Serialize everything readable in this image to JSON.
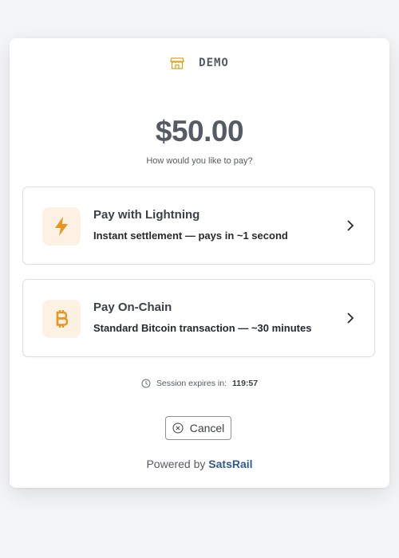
{
  "merchant": {
    "name": "DEMO",
    "icon": "store-icon"
  },
  "payment": {
    "amount": "$50.00",
    "prompt": "How would you like to pay?"
  },
  "options": [
    {
      "title": "Pay with Lightning",
      "description": "Instant settlement — pays in ~1 second",
      "icon": "lightning-icon"
    },
    {
      "title": "Pay On-Chain",
      "description": "Standard Bitcoin transaction — ~30 minutes",
      "icon": "bitcoin-icon"
    }
  ],
  "session": {
    "label": "Session expires in:",
    "timer": "119:57"
  },
  "cancel_label": "Cancel",
  "footer": {
    "powered_by": "Powered by",
    "brand": "SatsRail"
  },
  "colors": {
    "accent": "#e8961e",
    "icon_bg": "#fdf1e3",
    "brand": "#2f5c8a",
    "merchant_icon": "#d4a82a"
  }
}
